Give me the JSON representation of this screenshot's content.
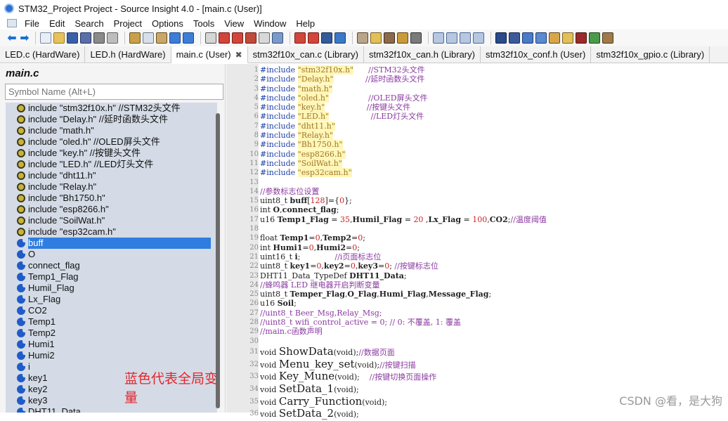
{
  "window": {
    "title": "STM32_Project Project - Source Insight 4.0 - [main.c (User)]"
  },
  "menu": [
    "File",
    "Edit",
    "Search",
    "Project",
    "Options",
    "Tools",
    "View",
    "Window",
    "Help"
  ],
  "tabs": [
    {
      "label": "LED.c (HardWare)",
      "active": false
    },
    {
      "label": "LED.h (HardWare)",
      "active": false
    },
    {
      "label": "main.c (User)",
      "active": true
    },
    {
      "label": "stm32f10x_can.c (Library)",
      "active": false
    },
    {
      "label": "stm32f10x_can.h (Library)",
      "active": false
    },
    {
      "label": "stm32f10x_conf.h (User)",
      "active": false
    },
    {
      "label": "stm32f10x_gpio.c (Library)",
      "active": false
    }
  ],
  "symbol_panel": {
    "file_name": "main.c",
    "search_placeholder": "Symbol Name (Alt+L)",
    "items": [
      {
        "label": "include \"stm32f10x.h\" //STM32头文件",
        "kind": "include"
      },
      {
        "label": "include \"Delay.h\" //延时函数头文件",
        "kind": "include"
      },
      {
        "label": "include \"math.h\"",
        "kind": "include"
      },
      {
        "label": "include \"oled.h\" //OLED屏头文件",
        "kind": "include"
      },
      {
        "label": "include \"key.h\" //按键头文件",
        "kind": "include"
      },
      {
        "label": "include \"LED.h\" //LED灯头文件",
        "kind": "include"
      },
      {
        "label": "include \"dht11.h\"",
        "kind": "include"
      },
      {
        "label": "include \"Relay.h\"",
        "kind": "include"
      },
      {
        "label": "include \"Bh1750.h\"",
        "kind": "include"
      },
      {
        "label": "include \"esp8266.h\"",
        "kind": "include"
      },
      {
        "label": "include \"SoilWat.h\"",
        "kind": "include"
      },
      {
        "label": "include \"esp32cam.h\"",
        "kind": "include"
      },
      {
        "label": "buff",
        "kind": "var",
        "selected": true
      },
      {
        "label": "O",
        "kind": "var"
      },
      {
        "label": "connect_flag",
        "kind": "var"
      },
      {
        "label": "Temp1_Flag",
        "kind": "var"
      },
      {
        "label": "Humil_Flag",
        "kind": "var"
      },
      {
        "label": "Lx_Flag",
        "kind": "var"
      },
      {
        "label": "CO2",
        "kind": "var"
      },
      {
        "label": "Temp1",
        "kind": "var"
      },
      {
        "label": "Temp2",
        "kind": "var"
      },
      {
        "label": "Humi1",
        "kind": "var"
      },
      {
        "label": "Humi2",
        "kind": "var"
      },
      {
        "label": "i",
        "kind": "var"
      },
      {
        "label": "key1",
        "kind": "var"
      },
      {
        "label": "key2",
        "kind": "var"
      },
      {
        "label": "key3",
        "kind": "var"
      },
      {
        "label": "DHT11_Data",
        "kind": "var"
      }
    ],
    "annotation": "蓝色代表全局变量"
  },
  "editor": {
    "lines": [
      {
        "n": "1",
        "html": "<span class=\"kw\">#include</span> <span class=\"str\">\"stm32f10x.h\"</span>      <span class=\"cm\">//STM32头文件</span>"
      },
      {
        "n": "2",
        "html": "<span class=\"kw\">#include</span> <span class=\"str\">\"Delay.h\"</span>             <span class=\"cm\">//延时函数头文件</span>"
      },
      {
        "n": "3",
        "html": "<span class=\"kw\">#include</span> <span class=\"str\">\"math.h\"</span>"
      },
      {
        "n": "4",
        "html": "<span class=\"kw\">#include</span> <span class=\"str\">\"oled.h\"</span>                <span class=\"cm\">//OLED屏头文件</span>"
      },
      {
        "n": "5",
        "html": "<span class=\"kw\">#include</span> <span class=\"str\">\"key.h\"</span>                 <span class=\"cm\">//按键头文件</span>"
      },
      {
        "n": "6",
        "html": "<span class=\"kw\">#include</span> <span class=\"str\">\"LED.h\"</span>                 <span class=\"cm\">//LED灯头文件</span>"
      },
      {
        "n": "7",
        "html": "<span class=\"kw\">#include</span> <span class=\"str\">\"dht11.h\"</span>"
      },
      {
        "n": "8",
        "html": "<span class=\"kw\">#include</span> <span class=\"str\">\"Relay.h\"</span>"
      },
      {
        "n": "9",
        "html": "<span class=\"kw\">#include</span> <span class=\"str\">\"Bh1750.h\"</span>"
      },
      {
        "n": "10",
        "html": "<span class=\"kw\">#include</span> <span class=\"str\">\"esp8266.h\"</span>"
      },
      {
        "n": "11",
        "html": "<span class=\"kw\">#include</span> <span class=\"str\">\"SoilWat.h\"</span>"
      },
      {
        "n": "12",
        "html": "<span class=\"kw\">#include</span> <span class=\"str\">\"esp32cam.h\"</span>"
      },
      {
        "n": "13",
        "html": ""
      },
      {
        "n": "14",
        "html": "<span class=\"cm\">//参数标志位设置</span>"
      },
      {
        "n": "15",
        "html": "uint8_t <span class=\"bold\">buff</span>[<span class=\"num\">128</span>]={<span class=\"num\">0</span>};"
      },
      {
        "n": "16",
        "html": "int <span class=\"bold\">O</span>,<span class=\"bold\">connect_flag</span>;"
      },
      {
        "n": "17",
        "html": "u16 <span class=\"bold\">Temp1_Flag</span> = <span class=\"num\">35</span>,<span class=\"bold\">Humil_Flag</span> = <span class=\"num\">20</span> ,<span class=\"bold\">Lx_Flag</span> = <span class=\"num\">100</span>,<span class=\"bold\">CO2</span>;<span class=\"cm\">//温度阈值</span>"
      },
      {
        "n": "18",
        "html": ""
      },
      {
        "n": "19",
        "html": "float <span class=\"bold\">Temp1</span>=<span class=\"num\">0</span>,<span class=\"bold\">Temp2</span>=<span class=\"num\">0</span>;"
      },
      {
        "n": "20",
        "html": "int <span class=\"bold\">Humi1</span>=<span class=\"num\">0</span>,<span class=\"bold\">Humi2</span>=<span class=\"num\">0</span>;"
      },
      {
        "n": "21",
        "html": "uint16_t <span class=\"bold\">i</span>;              <span class=\"cm\">//i页面标志位</span>"
      },
      {
        "n": "22",
        "html": "uint8_t <span class=\"bold\">key1</span>=<span class=\"num\">0</span>,<span class=\"bold\">key2</span>=<span class=\"num\">0</span>,<span class=\"bold\">key3</span>=<span class=\"num\">0</span>; <span class=\"cm\">//按键标志位</span>"
      },
      {
        "n": "23",
        "html": "DHT11_Data_TypeDef <span class=\"bold\">DHT11_Data</span>;"
      },
      {
        "n": "24",
        "html": "<span class=\"cm\">//蜂鸣器 LED 继电器开启判断变量</span>"
      },
      {
        "n": "25",
        "html": "uint8_t <span class=\"bold\">Temper_Flag</span>,<span class=\"bold\">O_Flag</span>,<span class=\"bold\">Humi_Flag</span>,<span class=\"bold\">Message_Flag</span>;"
      },
      {
        "n": "26",
        "html": "u16 <span class=\"bold\">Soil</span>;"
      },
      {
        "n": "27",
        "html": "<span class=\"cm\">//uint8_t Beer_Msg,Relay_Msg;</span>"
      },
      {
        "n": "28",
        "html": "<span class=\"cm\">//uint8_t wifi_control_active = 0; // 0: 不覆盖, 1: 覆盖</span>"
      },
      {
        "n": "29",
        "html": "<span class=\"cm\">//main.c函数声明</span>"
      },
      {
        "n": "30",
        "html": ""
      },
      {
        "n": "31",
        "big": true,
        "html": "void <span class=\"fn\">ShowData</span>(void);<span class=\"cm\">//数据页面</span>"
      },
      {
        "n": "32",
        "big": true,
        "html": "void <span class=\"fn\">Menu_key_set</span>(void);<span class=\"cm\">//按键扫描</span>"
      },
      {
        "n": "33",
        "big": true,
        "html": "void <span class=\"fn\">Key_Mune</span>(void);    <span class=\"cm\">//按键切换页面操作</span>"
      },
      {
        "n": "34",
        "big": true,
        "html": "void <span class=\"fn\">SetData_1</span>(void);"
      },
      {
        "n": "35",
        "big": true,
        "html": "void <span class=\"fn\">Carry_Function</span>(void);"
      },
      {
        "n": "36",
        "big": true,
        "html": "void <span class=\"fn\">SetData_2</span>(void);"
      }
    ]
  },
  "watermark": "CSDN @看，是大狗"
}
